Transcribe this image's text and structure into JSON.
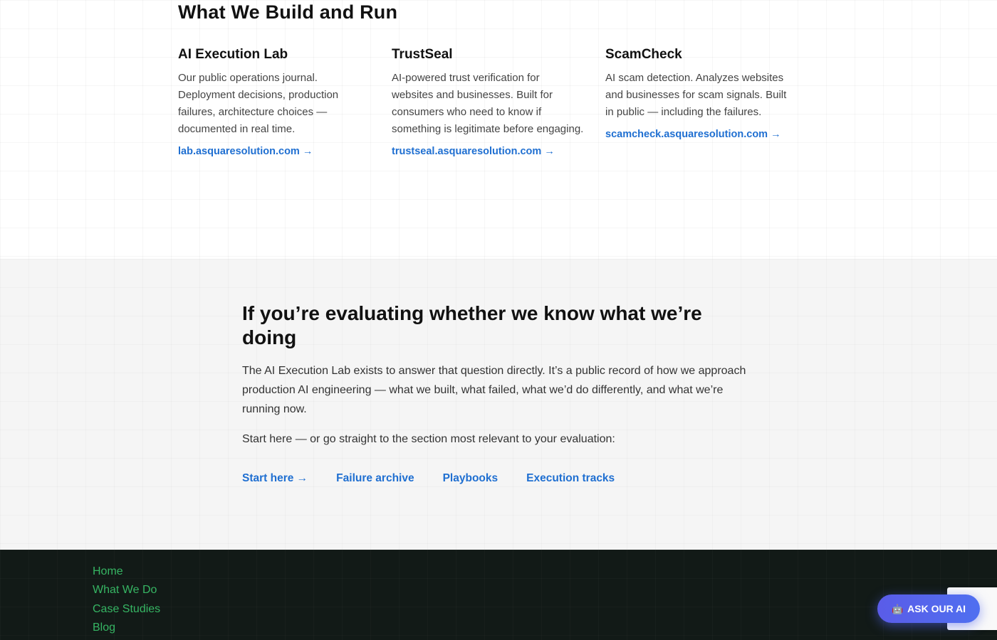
{
  "build": {
    "title": "What We Build and Run",
    "cards": [
      {
        "title": "AI Execution Lab",
        "description": "Our public operations journal. Deployment decisions, production failures, architecture choices — documented in real time.",
        "link": "lab.asquaresolution.com →"
      },
      {
        "title": "TrustSeal",
        "description": "AI-powered trust verification for websites and businesses. Built for consumers who need to know if something is legitimate before engaging.",
        "link": "trustseal.asquaresolution.com →"
      },
      {
        "title": "ScamCheck",
        "description": "AI scam detection. Analyzes websites and businesses for scam signals. Built in public — including the failures.",
        "link": "scamcheck.asquaresolution.com →"
      }
    ]
  },
  "evaluate": {
    "title": "If you’re evaluating whether we know what we’re doing",
    "body": "The AI Execution Lab exists to answer that question directly. It’s a public record of how we approach production AI engineering — what we built, what failed, what we’d do differently, and what we’re running now.",
    "lead": "Start here — or go straight to the section most relevant to your evaluation:",
    "links": [
      "Start here →",
      "Failure archive",
      "Playbooks",
      "Execution tracks"
    ]
  },
  "footer": {
    "nav": [
      "Home",
      "What We Do",
      "Case Studies",
      "Blog"
    ]
  },
  "widget": {
    "ask_ai_label": "ASK OUR AI",
    "ask_ai_icon": "robot-icon"
  },
  "colors": {
    "link": "#1f6fd1",
    "footer_bg": "#121a17",
    "footer_link": "#36b563",
    "ask_ai": "#5a5ce8"
  }
}
